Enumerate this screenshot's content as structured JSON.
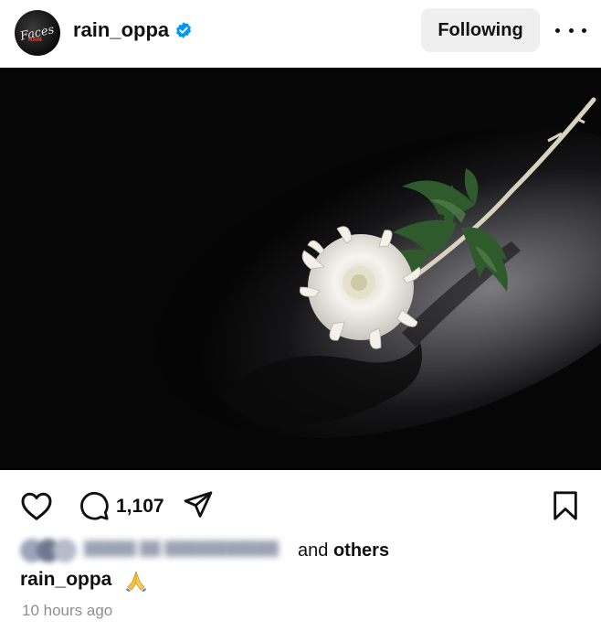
{
  "header": {
    "username": "rain_oppa",
    "follow_label": "Following",
    "avatar_icon": "profile-photo",
    "verified_icon": "verified-badge-icon",
    "more_icon": "more-options-icon"
  },
  "post": {
    "image_subject": "white chrysanthemum on dark background",
    "actions": {
      "like_icon": "heart-icon",
      "comment_icon": "comment-icon",
      "comment_count": "1,107",
      "share_icon": "send-icon",
      "save_icon": "bookmark-icon"
    },
    "likes": {
      "and_text": "and",
      "others_text": "others"
    },
    "caption": {
      "username": "rain_oppa",
      "emoji": "folded-hands"
    },
    "timestamp": "10 hours ago"
  },
  "colors": {
    "verified_blue": "#0095f6",
    "button_bg": "#efefef",
    "muted_text": "#8e8e8e"
  }
}
